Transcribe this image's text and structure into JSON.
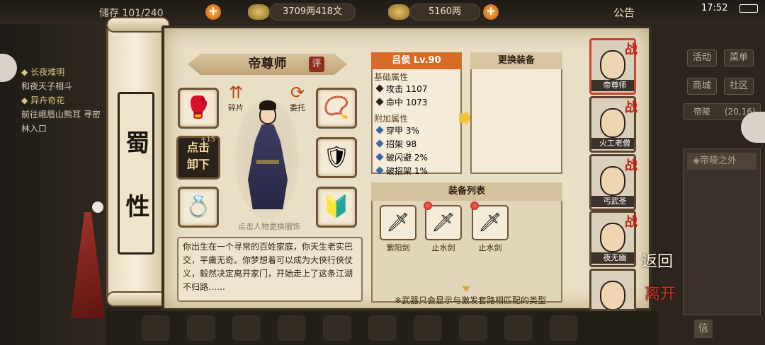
{
  "top_bar": {
    "bag": "储存 101/240",
    "silver": "3709两418文",
    "gold": "5160两",
    "notice": "公告",
    "time": "17:52"
  },
  "scroll": {
    "category": "蜀 性"
  },
  "left_panel": {
    "quests": [
      {
        "title": "长夜难明",
        "detail": "和夜天子相斗"
      },
      {
        "title": "异卉奇花",
        "detail": "前往峨眉山熊耳 寻密林入口"
      }
    ]
  },
  "character": {
    "title": "帝尊师",
    "rate": "评",
    "fragment_label": "碎片",
    "entrust_label": "委托",
    "unequip_label": "点击\n卸下",
    "unequip_level": "+15",
    "hint": "点击人物更换服饰",
    "description": "你出生在一个寻常的百姓家庭，你天生老实巴交，平庸无奇。你梦想着可以成为大侠行侠仗义，毅然决定离开家门，开始走上了这条江湖不归路……"
  },
  "stats": {
    "header": "吕侯 Lv.90",
    "base_title": "基础属性",
    "base": [
      {
        "name": "攻击",
        "value": "1107"
      },
      {
        "name": "命中",
        "value": "1073"
      }
    ],
    "extra_title": "附加属性",
    "extra": [
      {
        "name": "穿甲",
        "value": "3%"
      },
      {
        "name": "招架",
        "value": "98"
      },
      {
        "name": "破闪避",
        "value": "2%"
      },
      {
        "name": "破招架",
        "value": "1%"
      }
    ]
  },
  "change_equipment": {
    "header": "更换装备"
  },
  "equipment_list": {
    "header": "装备列表",
    "items": [
      {
        "name": "紫阳剑",
        "new": false
      },
      {
        "name": "止水剑",
        "new": true
      },
      {
        "name": "止水剑",
        "new": true
      }
    ],
    "note": "※武器只会显示与激发套路相匹配的类型"
  },
  "roster": [
    {
      "name": "帝尊师",
      "battle": "战",
      "active": true
    },
    {
      "name": "火工老僧",
      "battle": "战",
      "active": false
    },
    {
      "name": "丐武圣",
      "battle": "战",
      "active": false
    },
    {
      "name": "夜无幽",
      "battle": "战",
      "active": false
    },
    {
      "name": "",
      "battle": "",
      "active": false
    }
  ],
  "right_hud": {
    "buttons": [
      "活动",
      "菜单",
      "商城",
      "社区"
    ],
    "location": "帝陵",
    "coords": "(20,16)",
    "map_entry": "帝陵之外",
    "mail": "信"
  },
  "actions": {
    "return": "返回",
    "leave": "离开"
  },
  "colors": {
    "accent": "#d86b27",
    "paper": "#e9dfc6",
    "battle": "#c2231a"
  }
}
